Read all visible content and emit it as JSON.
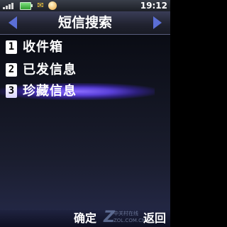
{
  "status_bar": {
    "time": "19:12",
    "icons": [
      "signal-icon",
      "battery-icon",
      "message-icon",
      "app-icon"
    ]
  },
  "header": {
    "title": "短信搜索"
  },
  "menu": {
    "items": [
      {
        "number": "1",
        "label": "收件箱"
      },
      {
        "number": "2",
        "label": "已发信息"
      },
      {
        "number": "3",
        "label": "珍藏信息"
      }
    ],
    "selected_index": 2
  },
  "softkeys": {
    "left": "确定",
    "right": "返回"
  },
  "watermark": {
    "line1": "中关村在线",
    "line2": "ZOL.COM.CN"
  },
  "colors": {
    "highlight": "#5a40d8",
    "arrow": "#5b6fd6"
  }
}
